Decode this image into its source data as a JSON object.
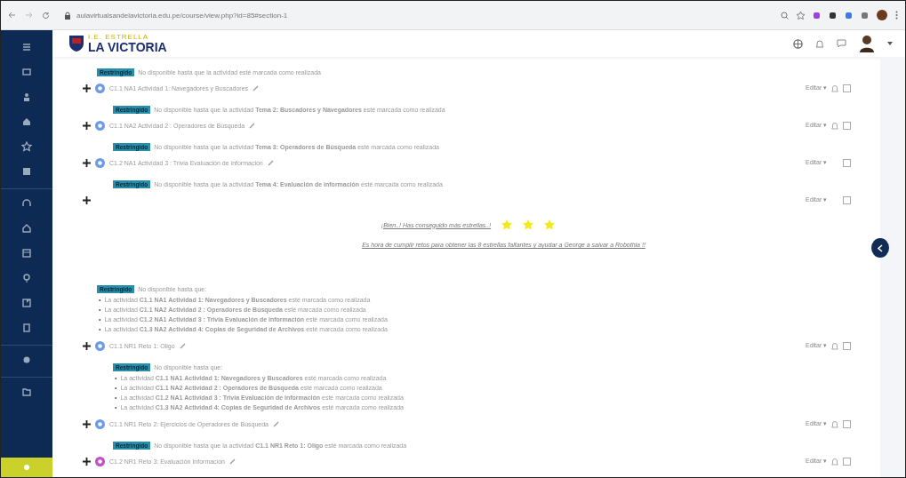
{
  "browser": {
    "url": "aulavirtualsandelavictoria.edu.pe/course/view.php?id=85#section-1"
  },
  "header": {
    "logo_small": "I.E. ESTRELLA",
    "logo_big": "LA VICTORIA"
  },
  "rows": [
    {
      "kind": "section_restriction",
      "badge": "Restringido",
      "text": "No disponible hasta que la actividad esté marcada como realizada"
    },
    {
      "kind": "activity",
      "color": "#6b9be8",
      "name": "C1.1 NA1 Actividad 1: Navegadores y Buscadores",
      "edit": "Editar ▾",
      "bell": true
    },
    {
      "kind": "restriction",
      "badge": "Restringido",
      "text": "No disponible hasta que la actividad **Tema 2: Buscadores y Navegadores** esté marcada como realizada"
    },
    {
      "kind": "activity",
      "color": "#6b9be8",
      "name": "C1.1 NA2 Actividad 2 : Operadores de Búsqueda",
      "edit": "Editar ▾",
      "bell": true
    },
    {
      "kind": "restriction",
      "badge": "Restringido",
      "text": "No disponible hasta que la actividad **Tema 3: Operadores de Búsqueda** esté marcada como realizada"
    },
    {
      "kind": "activity",
      "color": "#6b9be8",
      "name": "C1.2 NA1 Actividad 3 : Trivia Evaluación de información",
      "edit": "Editar ▾",
      "bell": false
    },
    {
      "kind": "restriction",
      "badge": "Restringido",
      "text": "No disponible hasta que la actividad **Tema 4: Evaluación de información** esté marcada como realizada"
    },
    {
      "kind": "plain",
      "edit": "Editar ▾"
    },
    {
      "kind": "stars",
      "text": "¡Bien..! Has conseguido más estrellas..!"
    },
    {
      "kind": "note",
      "text": "Es hora de cumplir retos para obtener las 8 estrellas faltantes y ayudar a George a salvar a Robothia !!"
    },
    {
      "kind": "section_list",
      "badge": "Restringido",
      "text": "No disponible hasta que:",
      "bullets": [
        {
          "marker": "•",
          "text": "La actividad **C1.1 NA1 Actividad 1: Navegadores y Buscadores** esté marcada como realizada"
        },
        {
          "marker": "•",
          "text": "La actividad **C1.1 NA2 Actividad 2 : Operadores de Búsqueda** esté marcada como realizada"
        },
        {
          "marker": "•",
          "text": "La actividad **C1.2 NA1 Actividad 3 : Trivia Evaluación de información** esté marcada como realizada"
        },
        {
          "marker": "•",
          "text": "La actividad **C1.3 NA2 Actividad 4: Copias de Seguridad de Archivos** esté marcada como realizada"
        }
      ]
    },
    {
      "kind": "activity",
      "color": "#6b9be8",
      "name": "C1.1 NR1 Reto 1: Oligo",
      "edit": "Editar ▾",
      "bell": true
    },
    {
      "kind": "list",
      "badge": "Restringido",
      "text": "No disponible hasta que:",
      "bullets": [
        {
          "marker": "•",
          "text": "La actividad **C1.1 NA1 Actividad 1: Navegadores y Buscadores** esté marcada como realizada"
        },
        {
          "marker": "•",
          "text": "La actividad **C1.1 NA2 Actividad 2 : Operadores de Búsqueda** esté marcada como realizada"
        },
        {
          "marker": "•",
          "text": "La actividad **C1.2 NA1 Actividad 3 : Trivia Evaluación de información** esté marcada como realizada"
        },
        {
          "marker": "•",
          "text": "La actividad **C1.3 NA2 Actividad 4: Copias de Seguridad de Archivos** esté marcada como realizada"
        }
      ]
    },
    {
      "kind": "activity",
      "color": "#6b9be8",
      "name": "C1.1 NR1 Reto 2: Ejercicios de Operadores de Búsqueda",
      "edit": "Editar ▾",
      "bell": true
    },
    {
      "kind": "restriction",
      "badge": "Restringido",
      "text": "No disponible hasta que la actividad **C1.1 NR1 Reto 1: Oligo** esté marcada como realizada"
    },
    {
      "kind": "activity",
      "color": "#c04fc8",
      "name": "C1.2 NR1 Reto 3: Evaluación Información",
      "edit": "Editar ▾",
      "bell": true
    }
  ]
}
